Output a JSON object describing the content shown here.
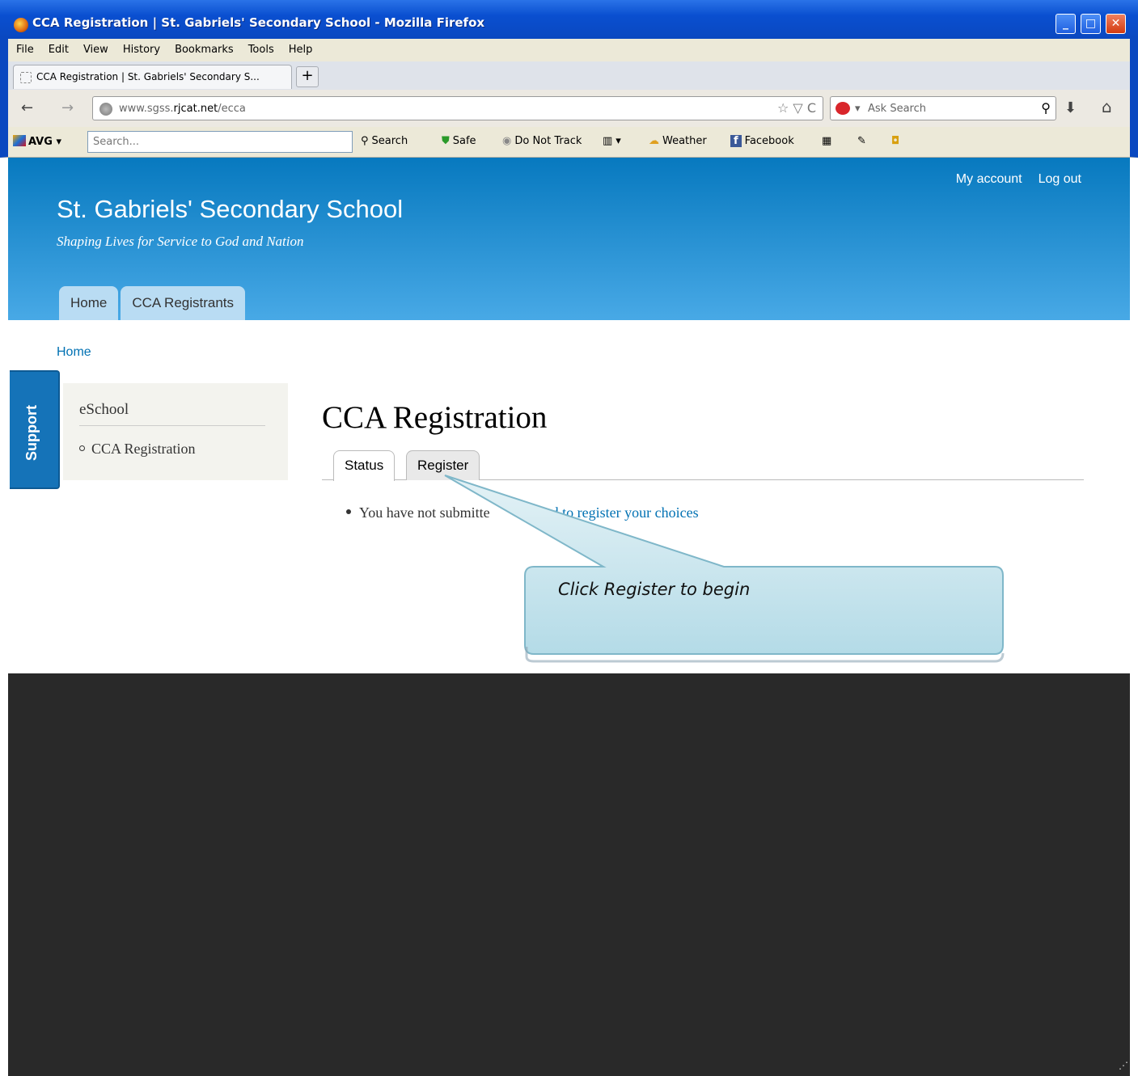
{
  "window": {
    "title": "CCA Registration | St. Gabriels' Secondary School - Mozilla Firefox",
    "minimize": "_",
    "maximize": "□",
    "close": "✕"
  },
  "menu": [
    "File",
    "Edit",
    "View",
    "History",
    "Bookmarks",
    "Tools",
    "Help"
  ],
  "browser_tab": {
    "label": "CCA Registration | St. Gabriels' Secondary S...",
    "new_tab": "+"
  },
  "nav": {
    "back": "←",
    "forward": "→",
    "url_prefix": "www.sgss.",
    "url_domain": "rjcat.net",
    "url_path": "/ecca",
    "url_icons": "☆ ▽ C",
    "ask_placeholder": "Ask Search",
    "ask_arrow": "▾",
    "magnifier": "⚲",
    "download": "⬇",
    "home": "⌂"
  },
  "avg": {
    "logo": "AVG",
    "dropdown": "▾",
    "search_placeholder": "Search...",
    "search_btn": "Search",
    "safe": "Safe",
    "do_not_track": "Do Not Track",
    "weather": "Weather",
    "facebook": "Facebook"
  },
  "site": {
    "name": "St. Gabriels' Secondary School",
    "slogan": "Shaping Lives for Service to God and Nation",
    "my_account": "My account",
    "log_out": "Log out",
    "main_tabs": [
      "Home",
      "CCA Registrants"
    ]
  },
  "breadcrumb": "Home",
  "support": "Support",
  "sidebar": {
    "title": "eSchool",
    "items": [
      "CCA Registration"
    ]
  },
  "content": {
    "title": "CCA Registration",
    "tabs": [
      "Status",
      "Register"
    ],
    "message_start": "You have not submitte",
    "message_link": "ceed to register your choices"
  },
  "callout": {
    "text": "Click Register to begin"
  }
}
